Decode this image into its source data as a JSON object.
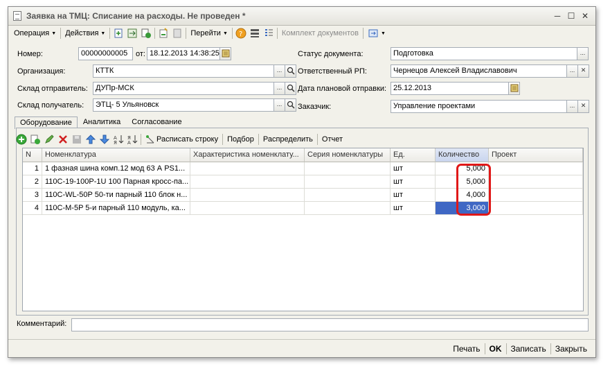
{
  "window": {
    "title": "Заявка на ТМЦ: Списание на расходы. Не проведен *"
  },
  "toolbar": {
    "operation": "Операция",
    "actions": "Действия",
    "goto": "Перейти",
    "docset": "Комплект документов"
  },
  "form": {
    "number_label": "Номер:",
    "number_value": "00000000005",
    "from_label": "от:",
    "date_value": "18.12.2013 14:38:25",
    "org_label": "Организация:",
    "org_value": "КТТК",
    "wh_from_label": "Склад отправитель:",
    "wh_from_value": "ДУПр-МСК",
    "wh_to_label": "Склад получатель:",
    "wh_to_value": "ЭТЦ- 5 Ульяновск",
    "status_label": "Статус документа:",
    "status_value": "Подготовка",
    "rp_label": "Ответственный РП:",
    "rp_value": "Чернецов Алексей Владиславович",
    "ship_label": "Дата плановой отправки:",
    "ship_value": "25.12.2013",
    "customer_label": "Заказчик:",
    "customer_value": "Управление проектами"
  },
  "tabs": [
    "Оборудование",
    "Аналитика",
    "Согласование"
  ],
  "subtoolbar": {
    "split_row": "Расписать строку",
    "pick": "Подбор",
    "distribute": "Распределить",
    "report": "Отчет"
  },
  "table": {
    "columns": [
      "N",
      "Номенклатура",
      "Характеристика номенклату...",
      "Серия номенклатуры",
      "Ед.",
      "Количество",
      "Проект"
    ],
    "rows": [
      {
        "n": "1",
        "name": "1 фазная шина комп.12 мод 63 А PS1...",
        "char": "",
        "series": "",
        "unit": "шт",
        "qty": "5,000",
        "project": ""
      },
      {
        "n": "2",
        "name": "110C-19-100P-1U 100 Парная кросс-па...",
        "char": "",
        "series": "",
        "unit": "шт",
        "qty": "5,000",
        "project": ""
      },
      {
        "n": "3",
        "name": "110C-WL-50P 50-ти парный 110 блок н...",
        "char": "",
        "series": "",
        "unit": "шт",
        "qty": "4,000",
        "project": ""
      },
      {
        "n": "4",
        "name": "110C-M-5P 5-и парный 110 модуль, ка...",
        "char": "",
        "series": "",
        "unit": "шт",
        "qty": "3,000",
        "project": ""
      }
    ]
  },
  "comment": {
    "label": "Комментарий:",
    "value": ""
  },
  "bottom": {
    "print": "Печать",
    "ok": "OK",
    "save": "Записать",
    "close": "Закрыть"
  },
  "colors": {
    "selection": "#3f67c4",
    "highlight": "#e01818",
    "window_bg": "#f2f1ea"
  }
}
